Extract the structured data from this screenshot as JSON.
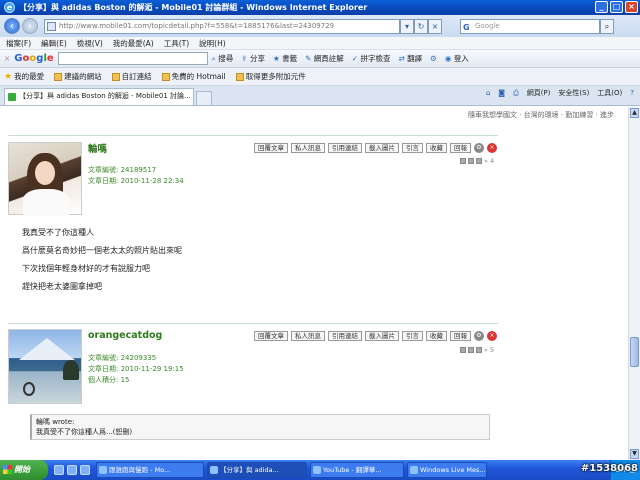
{
  "window": {
    "title": "【分享】與 adidas Boston 的解逅 - Mobile01 討論群組 - Windows Internet Explorer",
    "logo_text": "e"
  },
  "addressbar": {
    "url": "http://www.mobile01.com/topicdetail.php?f=558&t=1885176&last=24309729",
    "search_placeholder": "Google",
    "search_logo": "G"
  },
  "menubar": [
    "檔案(F)",
    "編輯(E)",
    "檢視(V)",
    "我的最愛(A)",
    "工具(T)",
    "說明(H)"
  ],
  "google_toolbar": {
    "logo": [
      "G",
      "o",
      "o",
      "g",
      "l",
      "e"
    ],
    "items": [
      {
        "icon": "search-icon",
        "label": "搜尋"
      },
      {
        "icon": "share-icon",
        "label": "分享"
      },
      {
        "icon": "bookmark-icon",
        "label": "書籤"
      },
      {
        "icon": "translate-icon",
        "label": "網頁註解"
      },
      {
        "icon": "spellcheck-icon",
        "label": "拼字檢查"
      },
      {
        "icon": "translate-icon",
        "label": "翻譯"
      },
      {
        "icon": "login-icon",
        "label": "登入"
      }
    ]
  },
  "favorites": {
    "label": "我的最愛",
    "items": [
      "建議的網站",
      "自訂連結",
      "免費的 Hotmail",
      "取得更多附加元件"
    ]
  },
  "tab": {
    "label": "【分享】與 adidas Boston 的解逅 - Mobile01 討論..."
  },
  "commandbar": [
    "網頁(P)",
    "安全性(S)",
    "工具(O)"
  ],
  "page": {
    "hint": "隨車我想學國文 · 台灣的環境 · 勤加練習 · 進步",
    "posts": [
      {
        "username": "輪嗎",
        "post_id_label": "文章編號:",
        "post_id": "24189517",
        "date_label": "文章日期:",
        "date": "2010-11-28 22:34",
        "floor": "4",
        "lines": [
          "我真受不了你這種人",
          "爲什麼莫名奇妙把一個老太太的照片貼出來呢",
          "下次找個年輕身材好的才有說服力吧",
          "趕快把老太婆圖拿掉吧"
        ]
      },
      {
        "username": "orangecatdog",
        "post_id_label": "文章編號:",
        "post_id": "24209335",
        "date_label": "文章日期:",
        "date": "2010-11-29 19:15",
        "points_label": "個人積分:",
        "points": "15",
        "floor": "5",
        "quote_author": "輪嗎 wrote:",
        "quote_text": "我真受不了你這種人爲...(恕刪)"
      }
    ],
    "actions": [
      "回覆文章",
      "私人訊息",
      "引用連結",
      "載入圖片",
      "引言",
      "收藏",
      "回報"
    ]
  },
  "taskbar": {
    "start": "開始",
    "tasks": [
      "跟誰跑與慢跑 - Mo...",
      "【分享】與 adida...",
      "YouTube - 翻譯華...",
      "Windows Live Mes..."
    ],
    "lang": "CH",
    "watermark": "#1538068"
  }
}
